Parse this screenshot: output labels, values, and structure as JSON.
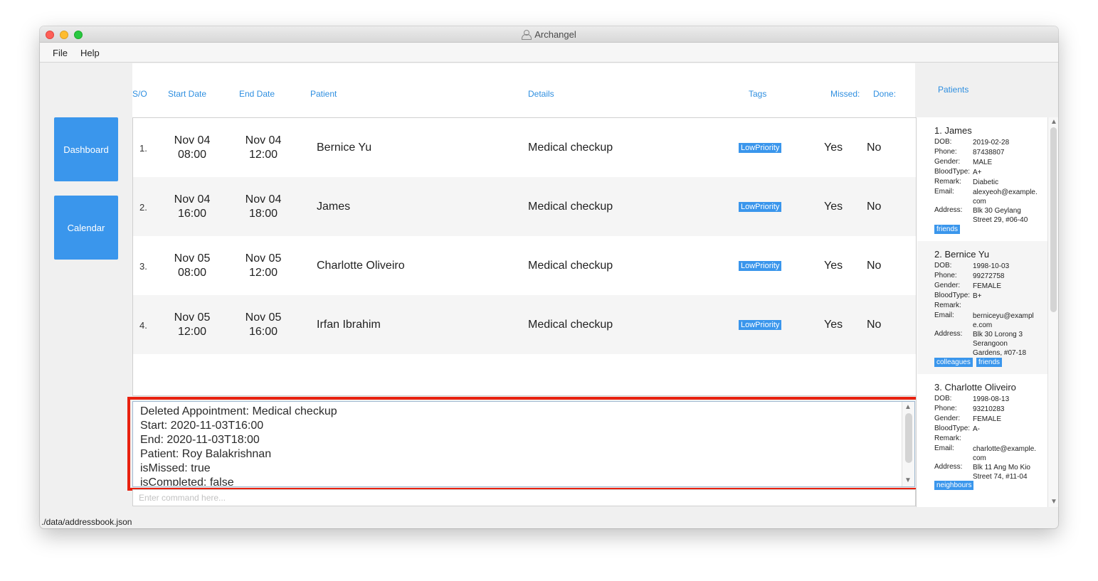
{
  "window": {
    "title": "Archangel"
  },
  "menu": {
    "file": "File",
    "help": "Help"
  },
  "nav": {
    "dashboard": "Dashboard",
    "calendar": "Calendar"
  },
  "columns": {
    "so": "S/O",
    "start": "Start Date",
    "end": "End Date",
    "patient": "Patient",
    "details": "Details",
    "tags": "Tags",
    "missed": "Missed:",
    "done": "Done:"
  },
  "appointments": [
    {
      "index": "1.",
      "start_date": "Nov 04",
      "start_time": "08:00",
      "end_date": "Nov 04",
      "end_time": "12:00",
      "patient": "Bernice Yu",
      "details": "Medical checkup",
      "tag": "LowPriority",
      "missed": "Yes",
      "done": "No"
    },
    {
      "index": "2.",
      "start_date": "Nov 04",
      "start_time": "16:00",
      "end_date": "Nov 04",
      "end_time": "18:00",
      "patient": "James",
      "details": "Medical checkup",
      "tag": "LowPriority",
      "missed": "Yes",
      "done": "No"
    },
    {
      "index": "3.",
      "start_date": "Nov 05",
      "start_time": "08:00",
      "end_date": "Nov 05",
      "end_time": "12:00",
      "patient": "Charlotte Oliveiro",
      "details": "Medical checkup",
      "tag": "LowPriority",
      "missed": "Yes",
      "done": "No"
    },
    {
      "index": "4.",
      "start_date": "Nov 05",
      "start_time": "12:00",
      "end_date": "Nov 05",
      "end_time": "16:00",
      "patient": "Irfan Ibrahim",
      "details": "Medical checkup",
      "tag": "LowPriority",
      "missed": "Yes",
      "done": "No"
    }
  ],
  "result": {
    "lines": [
      "Deleted Appointment: Medical checkup",
      "Start: 2020-11-03T16:00",
      "End: 2020-11-03T18:00",
      "Patient: Roy Balakrishnan",
      "isMissed: true",
      "isCompleted: false"
    ]
  },
  "command": {
    "placeholder": "Enter command here..."
  },
  "patients": {
    "title": "Patients",
    "labels": {
      "dob": "DOB:",
      "phone": "Phone:",
      "gender": "Gender:",
      "blood": "BloodType:",
      "remark": "Remark:",
      "email": "Email:",
      "address": "Address:"
    },
    "items": [
      {
        "name": "1. James",
        "dob": "2019-02-28",
        "phone": "87438807",
        "gender": "MALE",
        "blood": "A+",
        "remark": "Diabetic",
        "email": "alexyeoh@example.com",
        "address": "Blk 30 Geylang Street 29, #06-40",
        "tags": [
          "friends"
        ]
      },
      {
        "name": "2. Bernice Yu",
        "dob": "1998-10-03",
        "phone": "99272758",
        "gender": "FEMALE",
        "blood": "B+",
        "remark": "",
        "email": "berniceyu@example.com",
        "address": "Blk 30 Lorong 3 Serangoon Gardens, #07-18",
        "tags": [
          "colleagues",
          "friends"
        ]
      },
      {
        "name": "3. Charlotte Oliveiro",
        "dob": "1998-08-13",
        "phone": "93210283",
        "gender": "FEMALE",
        "blood": "A-",
        "remark": "",
        "email": "charlotte@example.com",
        "address": "Blk 11 Ang Mo Kio Street 74, #11-04",
        "tags": [
          "neighbours"
        ]
      }
    ]
  },
  "status": {
    "path": "./data/addressbook.json"
  }
}
